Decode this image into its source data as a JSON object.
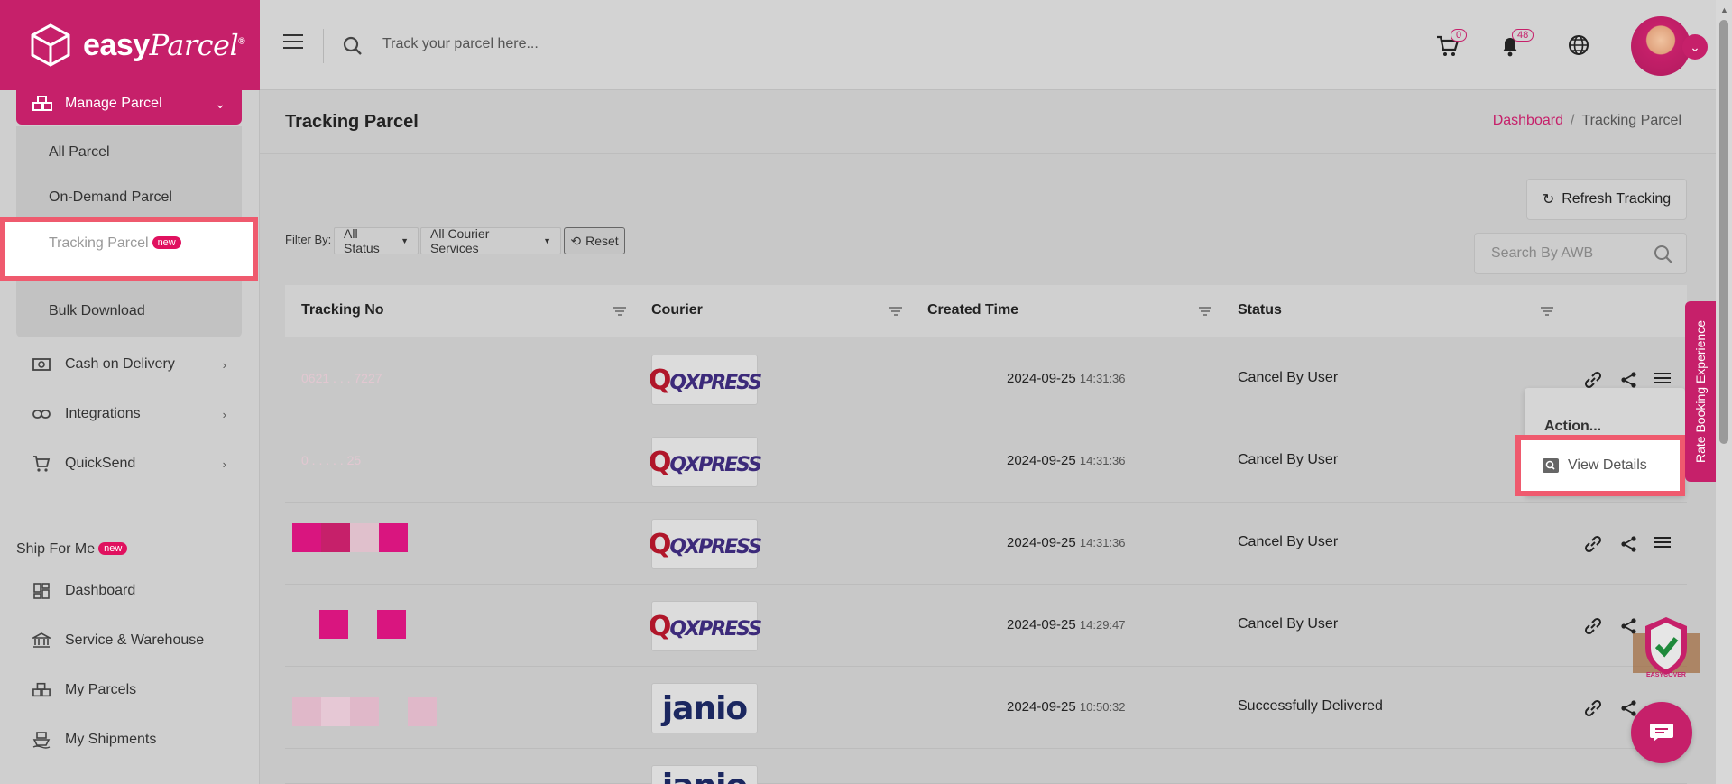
{
  "brand": {
    "name": "easy",
    "name_italic": "Parcel",
    "reg": "®"
  },
  "sidebar": {
    "active_menu": "Manage Parcel",
    "submenu": [
      "All Parcel",
      "On-Demand Parcel",
      "Tracking Parcel",
      "Bulk Download"
    ],
    "submenu_badge": "new",
    "items": [
      "Cash on Delivery",
      "Integrations",
      "QuickSend"
    ],
    "section": {
      "label": "Ship For Me",
      "badge": "new"
    },
    "section_items": [
      "Dashboard",
      "Service & Warehouse",
      "My Parcels",
      "My Shipments"
    ]
  },
  "topbar": {
    "search_placeholder": "Track your parcel here...",
    "cart_count": "0",
    "notification_count": "48"
  },
  "page": {
    "title": "Tracking Parcel",
    "breadcrumb": [
      "Dashboard",
      "Tracking Parcel"
    ],
    "refresh_label": "Refresh Tracking",
    "awb_placeholder": "Search By AWB",
    "filter_label": "Filter By:",
    "status_filter": "All Status",
    "courier_filter": "All Courier Services",
    "reset_label": "Reset"
  },
  "table": {
    "columns": [
      "Tracking No",
      "Courier",
      "Created Time",
      "Status"
    ],
    "rows": [
      {
        "tracking": "0621 . . . 7227",
        "courier": "QXPRESS",
        "date": "2024-09-25",
        "time": "14:31:36",
        "status": "Cancel By User"
      },
      {
        "tracking": "0 . . . . . 25",
        "courier": "QXPRESS",
        "date": "2024-09-25",
        "time": "14:31:36",
        "status": "Cancel By User"
      },
      {
        "tracking": "",
        "courier": "QXPRESS",
        "date": "2024-09-25",
        "time": "14:31:36",
        "status": "Cancel By User"
      },
      {
        "tracking": "",
        "courier": "QXPRESS",
        "date": "2024-09-25",
        "time": "14:29:47",
        "status": "Cancel By User"
      },
      {
        "tracking": "",
        "courier": "janio",
        "date": "2024-09-25",
        "time": "10:50:32",
        "status": "Successfully Delivered"
      }
    ]
  },
  "dropdown": {
    "heading": "Action...",
    "item": "View Details"
  },
  "rate_tab": "Rate Booking Experience",
  "easycover_label": "EASYCOVER",
  "colors": {
    "brand": "#c6206a",
    "highlight": "#ef5a6e"
  }
}
